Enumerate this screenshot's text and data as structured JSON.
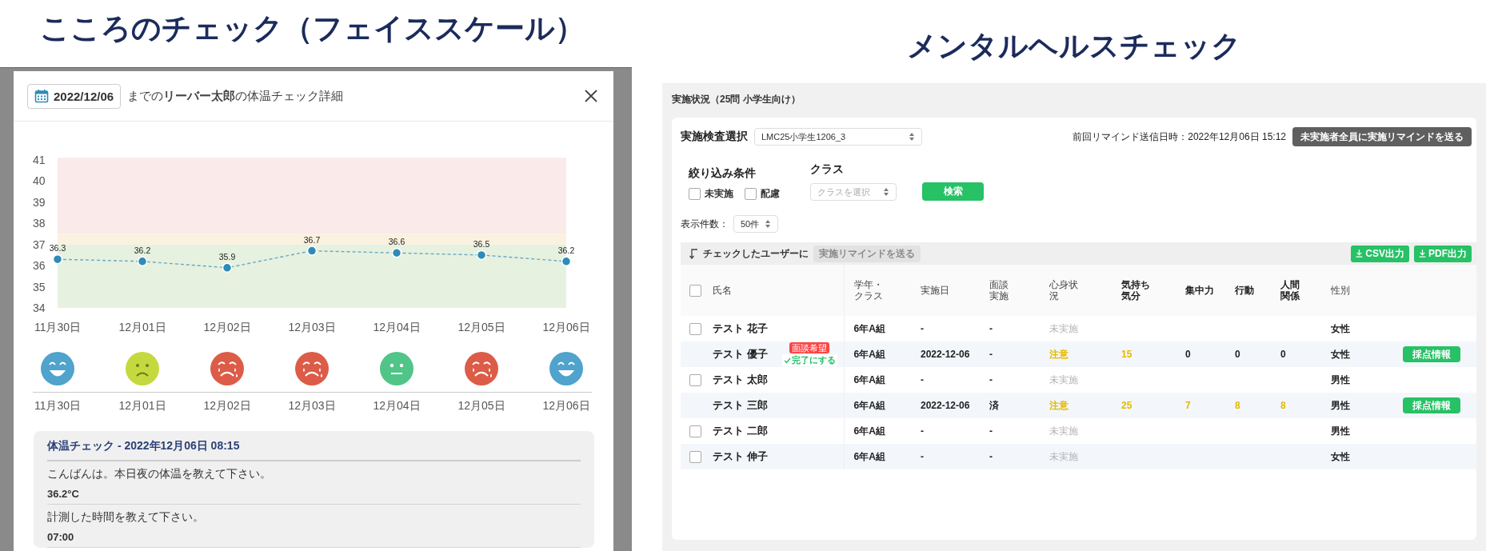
{
  "left_title": "こころのチェック（フェイススケール）",
  "right_title": "メンタルヘルスチェック",
  "face_scale_dialog": {
    "date_button": "2022/12/06",
    "heading": "までの**リーバー太郎**の体温チェック詳細",
    "chart_data": {
      "type": "line",
      "categories": [
        "11月30日",
        "12月01日",
        "12月02日",
        "12月03日",
        "12月04日",
        "12月05日",
        "12月06日"
      ],
      "series": [
        {
          "color": "#2e8bb8",
          "line_style": "dashed",
          "marker": "circle",
          "values": [
            36.3,
            36.2,
            35.9,
            36.7,
            36.6,
            36.5,
            36.2
          ]
        }
      ],
      "ylim": [
        34,
        41.1
      ],
      "yticks": [
        34,
        35,
        36,
        37,
        38,
        39,
        40,
        41
      ],
      "data_labels": true,
      "bands": [
        {
          "axis": "y",
          "from": 37.5,
          "to": 41.1,
          "color": "#fbeaea"
        },
        {
          "axis": "y",
          "from": 37,
          "to": 37.5,
          "color": "#fbf1df"
        },
        {
          "axis": "y",
          "from": 34,
          "to": 37,
          "color": "#e7f1e0"
        }
      ]
    },
    "faces": [
      {
        "date": "11月30日",
        "kind": "happy",
        "color": "#4fa3cc"
      },
      {
        "date": "12月01日",
        "kind": "sad",
        "color": "#c4d93e"
      },
      {
        "date": "12月02日",
        "kind": "crying",
        "color": "#dc5c48"
      },
      {
        "date": "12月03日",
        "kind": "crying",
        "color": "#dc5c48"
      },
      {
        "date": "12月04日",
        "kind": "neutral",
        "color": "#50c587"
      },
      {
        "date": "12月05日",
        "kind": "crying",
        "color": "#dc5c48"
      },
      {
        "date": "12月06日",
        "kind": "happy",
        "color": "#4fa3cc"
      }
    ],
    "record": {
      "title": "体温チェック - 2022年12月06日 08:15",
      "items": [
        {
          "question": "こんばんは。本日夜の体温を教えて下さい。",
          "answer": "36.2°C"
        },
        {
          "question": "計測した時間を教えて下さい。",
          "answer": "07:00"
        }
      ]
    }
  },
  "mental_health": {
    "section_title": "実施状況（25問 小学生向け）",
    "exam_label": "実施検査選択",
    "exam_value": "LMC25小学生1206_3",
    "last_remind": "前回リマインド送信日時：2022年12月06日 15:12",
    "remind_all_button": "未実施者全員に実施リマインドを送る",
    "filter_label": "絞り込み条件",
    "filters": [
      {
        "label": "未実施",
        "checked": false
      },
      {
        "label": "配慮",
        "checked": false
      }
    ],
    "class_label": "クラス",
    "class_placeholder": "クラスを選択",
    "search_button": "検索",
    "page_size_label": "表示件数：",
    "page_size": "50件",
    "bulk_label": "チェックしたユーザーに",
    "bulk_button": {
      "label": "実施リマインドを送る",
      "disabled": true
    },
    "export_buttons": [
      "CSV出力",
      "PDF出力"
    ],
    "header_checkbox": {
      "checked": false
    },
    "columns": [
      {
        "label": "氏名",
        "bold": false
      },
      {
        "label": "学年・クラス",
        "bold": false
      },
      {
        "label": "実施日",
        "bold": false
      },
      {
        "label": "面談実施",
        "bold": false
      },
      {
        "label": "心身状況",
        "bold": false
      },
      {
        "label": "気持ち気分",
        "bold": true
      },
      {
        "label": "集中力",
        "bold": true
      },
      {
        "label": "行動",
        "bold": true
      },
      {
        "label": "人間関係",
        "bold": true
      },
      {
        "label": "性別",
        "bold": false
      }
    ],
    "rows": [
      {
        "checked": false,
        "name": "テスト 花子",
        "class": "6年A組",
        "date": "-",
        "interview": "-",
        "status": {
          "text": "未実施",
          "kind": "pending"
        },
        "gender": "女性"
      },
      {
        "name": "テスト 優子",
        "request_tag": "面談希望",
        "complete_link": "完了にする",
        "class": "6年A組",
        "date": "2022-12-06",
        "interview": "-",
        "status": {
          "text": "注意",
          "kind": "caution"
        },
        "scores": [
          {
            "text": "15",
            "alert": true
          },
          {
            "text": "0",
            "alert": false
          },
          {
            "text": "0",
            "alert": false
          },
          {
            "text": "0",
            "alert": false
          }
        ],
        "gender": "女性",
        "action": "採点情報"
      },
      {
        "checked": false,
        "name": "テスト 太郎",
        "class": "6年A組",
        "date": "-",
        "interview": "-",
        "status": {
          "text": "未実施",
          "kind": "pending"
        },
        "gender": "男性"
      },
      {
        "name": "テスト 三郎",
        "class": "6年A組",
        "date": "2022-12-06",
        "interview": "済",
        "status": {
          "text": "注意",
          "kind": "caution"
        },
        "scores": [
          {
            "text": "25",
            "alert": true
          },
          {
            "text": "7",
            "alert": true
          },
          {
            "text": "8",
            "alert": true
          },
          {
            "text": "8",
            "alert": true
          }
        ],
        "gender": "男性",
        "action": "採点情報"
      },
      {
        "checked": false,
        "name": "テスト 二郎",
        "class": "6年A組",
        "date": "-",
        "interview": "-",
        "status": {
          "text": "未実施",
          "kind": "pending"
        },
        "gender": "男性"
      },
      {
        "checked": false,
        "name": "テスト 伸子",
        "class": "6年A組",
        "date": "-",
        "interview": "-",
        "status": {
          "text": "未実施",
          "kind": "pending"
        },
        "gender": "女性"
      }
    ]
  }
}
